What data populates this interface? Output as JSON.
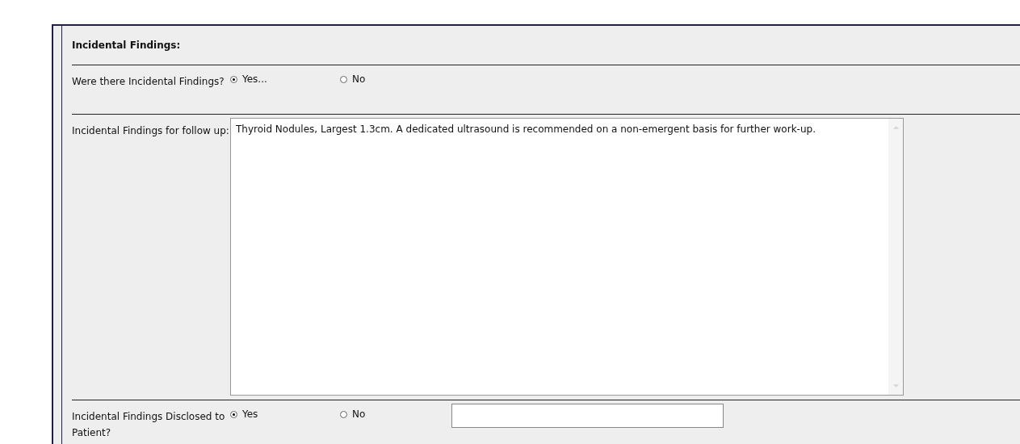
{
  "section": {
    "title": "Incidental Findings:"
  },
  "rows": [
    {
      "kind": "radio",
      "label": "Were there Incidental Findings?",
      "options": [
        {
          "label": "Yes...",
          "selected": true
        },
        {
          "label": "No",
          "selected": false
        }
      ]
    },
    {
      "kind": "textarea",
      "label": "Incidental Findings for follow up:",
      "value": "Thyroid Nodules, Largest 1.3cm. A dedicated ultrasound is recommended on a non-emergent basis for further work-up."
    },
    {
      "kind": "radio_text",
      "label": "Incidental Findings Disclosed to Patient?",
      "options": [
        {
          "label": "Yes",
          "selected": true
        },
        {
          "label": "No",
          "selected": false
        }
      ]
    }
  ]
}
